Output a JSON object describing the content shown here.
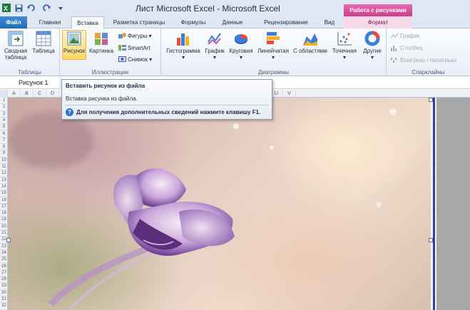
{
  "window": {
    "title": "Лист Microsoft Excel  -  Microsoft Excel",
    "context_tab_header": "Работа с рисунками"
  },
  "tabs": [
    "Файл",
    "Главная",
    "Вставка",
    "Разметка страницы",
    "Формулы",
    "Данные",
    "Рецензирование",
    "Вид",
    "Формат"
  ],
  "ribbon": {
    "tables": {
      "pivot_label": "Сводная таблица",
      "table_label": "Таблица",
      "group": "Таблицы"
    },
    "illustrations": {
      "picture": "Рисунок",
      "clipart": "Картинка",
      "shapes": "Фигуры",
      "smartart": "SmartArt",
      "screenshot": "Снимок",
      "group": "Иллюстрации"
    },
    "charts": {
      "histogram": "Гистограмма",
      "line": "График",
      "pie": "Круговая",
      "bar": "Линейчатая",
      "area": "С областями",
      "scatter": "Точечная",
      "other": "Другие",
      "group": "Диаграммы"
    },
    "sparklines": {
      "line": "График",
      "column": "Столбец",
      "winloss": "Выигрыш / проигрыш",
      "group": "Спарклайны"
    }
  },
  "name_box": "Рисунок 1",
  "columns": [
    "A",
    "B",
    "C",
    "D",
    "E",
    "F",
    "G",
    "H",
    "I",
    "J",
    "K",
    "L",
    "M",
    "N",
    "O",
    "P",
    "Q",
    "R",
    "S",
    "T",
    "U",
    "V"
  ],
  "rows": [
    "1",
    "2",
    "3",
    "4",
    "5",
    "6",
    "7",
    "8",
    "9",
    "10",
    "11",
    "12",
    "13",
    "14",
    "15",
    "16",
    "17",
    "18",
    "19",
    "20",
    "21",
    "22",
    "23",
    "24",
    "25",
    "26",
    "27",
    "28",
    "29",
    "30",
    "31",
    "32"
  ],
  "tooltip": {
    "title": "Вставить рисунок из файла",
    "description": "Вставка рисунка из файла.",
    "help": "Для получения дополнительных сведений нажмите клавишу F1."
  },
  "colors": {
    "file_tab": "#1f6bb8",
    "context_tab": "#cf3c8e",
    "selection_border": "#2c3fb4"
  }
}
